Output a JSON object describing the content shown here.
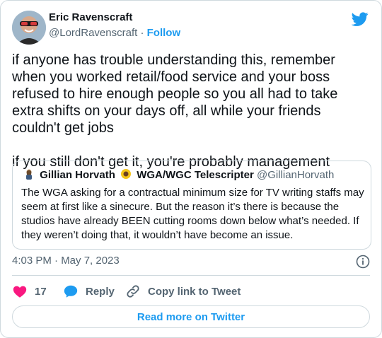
{
  "author": {
    "name": "Eric Ravenscraft",
    "handle": "@LordRavenscraft",
    "separator": " · ",
    "follow_label": "Follow"
  },
  "tweet": {
    "text": "if anyone has trouble understanding this, remember when you worked retail/food service and your boss refused to hire enough people so you all had to take extra shifts on your days off, all while your friends couldn't get jobs\n\nif you still don't get it, you're probably management"
  },
  "quote": {
    "name_part1": "Gillian Horvath",
    "name_part2": "WGA/WGC Telescripter",
    "handle": "@GillianHorvath",
    "text": "The WGA asking for a contractual minimum size for TV writing staffs may seem at first like a sinecure. But the reason it’s there is because the studios have already BEEN cutting rooms down below what’s needed.  If they weren’t doing that, it wouldn’t have become an issue."
  },
  "meta": {
    "timestamp": "4:03 PM · May 7, 2023"
  },
  "actions": {
    "like_count": "17",
    "reply_label": "Reply",
    "copy_label": "Copy link to Tweet"
  },
  "footer": {
    "read_more_label": "Read more on Twitter"
  },
  "colors": {
    "accent": "#1d9bf0",
    "like": "#f91880",
    "secondary_text": "#536471",
    "border": "#cfd9de"
  }
}
